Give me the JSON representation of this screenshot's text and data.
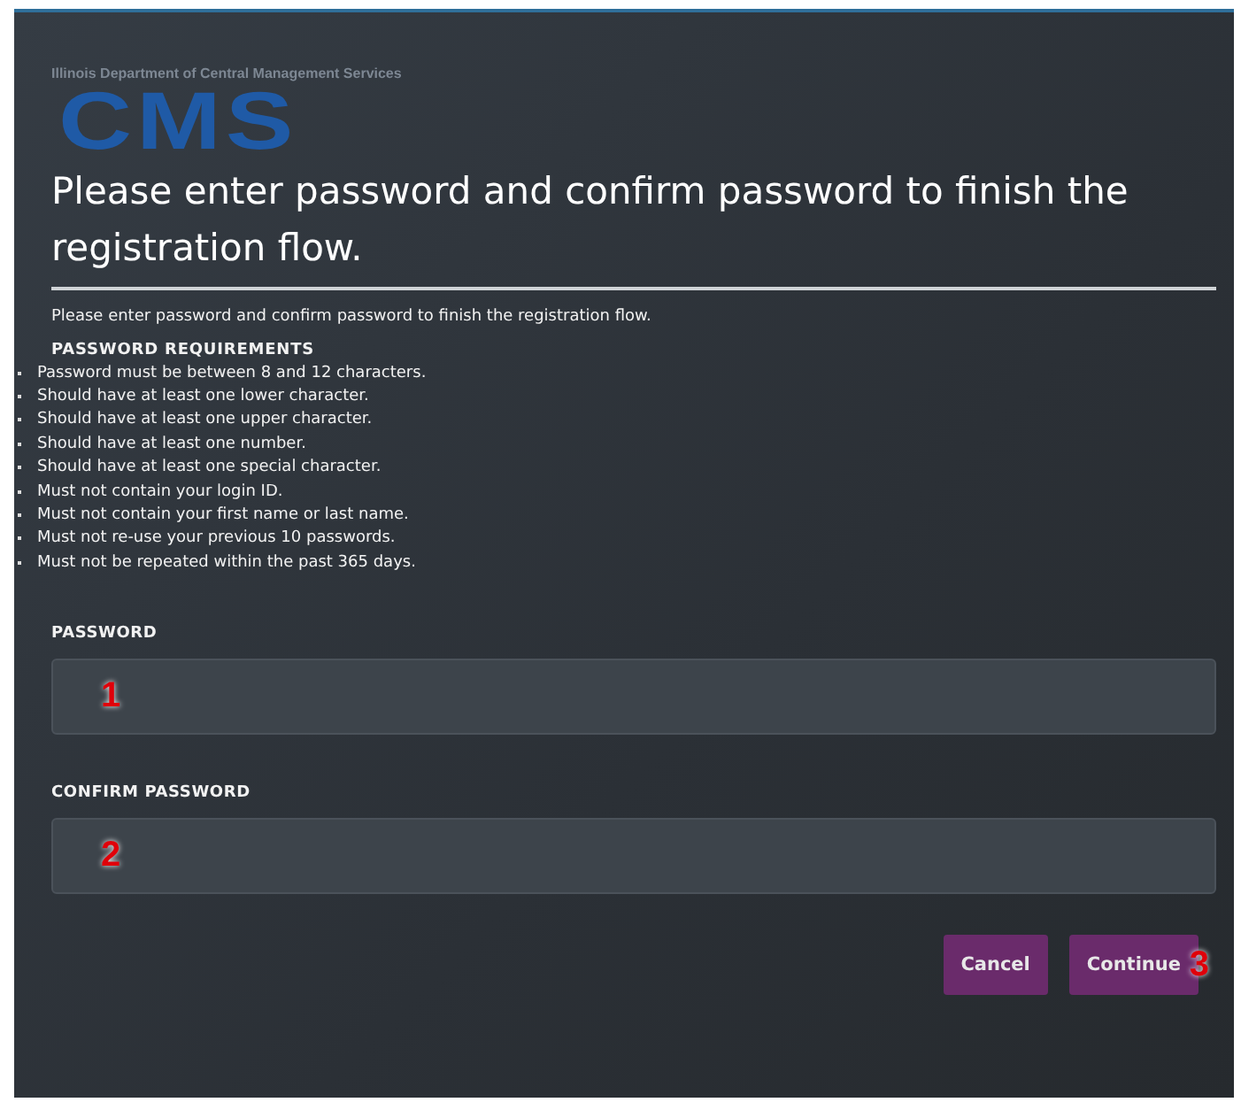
{
  "header": {
    "agency": "Illinois Department of Central Management Services",
    "logo": "CMS"
  },
  "title": "Please enter password and confirm password to finish the registration flow.",
  "intro": "Please enter password and confirm password to finish the registration flow.",
  "requirements": {
    "heading": "PASSWORD REQUIREMENTS",
    "items": [
      "Password must be between 8 and 12 characters.",
      "Should have at least one lower character.",
      "Should have at least one upper character.",
      "Should have at least one number.",
      "Should have at least one special character.",
      "Must not contain your login ID.",
      "Must not contain your first name or last name.",
      "Must not re-use your previous 10 passwords.",
      "Must not be repeated within the past 365 days."
    ]
  },
  "fields": [
    {
      "label": "PASSWORD",
      "callout": "1"
    },
    {
      "label": "CONFIRM PASSWORD",
      "callout": "2"
    }
  ],
  "buttons": [
    {
      "label": "Cancel"
    },
    {
      "label": "Continue",
      "callout": "3"
    }
  ]
}
